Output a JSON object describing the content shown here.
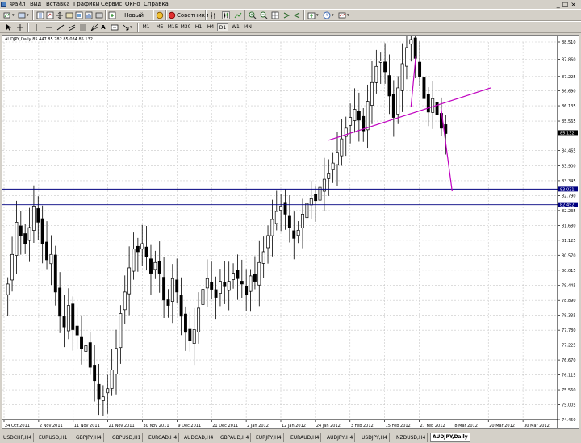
{
  "menubar": {
    "items": [
      "Файл",
      "Вид",
      "Вставка",
      "Графики",
      "Сервис",
      "Окно",
      "Справка"
    ]
  },
  "toolbar": {
    "new_order_label": "Новый Ордер",
    "advisors_label": "Советники",
    "timeframes": [
      "M1",
      "M5",
      "M15",
      "M30",
      "H1",
      "H4",
      "D1",
      "W1",
      "MN"
    ],
    "active_timeframe": "D1"
  },
  "chart": {
    "info": "AUDJPY,Daily  85.447 85.782 85.034 85.132",
    "current_price_tag": "85.132",
    "hline_upper_tag": "83.031",
    "hline_lower_tag": "82.452",
    "price_labels": [
      "88.510",
      "87.860",
      "87.225",
      "86.690",
      "86.135",
      "85.565",
      "84.465",
      "83.900",
      "83.345",
      "82.790",
      "82.235",
      "81.680",
      "81.125",
      "80.570",
      "80.015",
      "79.445",
      "78.890",
      "78.335",
      "77.780",
      "77.225",
      "76.670",
      "76.115",
      "75.560",
      "75.005",
      "74.450"
    ],
    "date_labels": [
      "24 Oct 2011",
      "2 Nov 2011",
      "11 Nov 2011",
      "21 Nov 2011",
      "30 Nov 2011",
      "9 Dec 2011",
      "21 Dec 2011",
      "2 Jan 2012",
      "12 Jan 2012",
      "24 Jan 2012",
      "3 Feb 2012",
      "15 Feb 2012",
      "27 Feb 2012",
      "8 Mar 2012",
      "20 Mar 2012",
      "30 Mar 2012"
    ],
    "colors": {
      "background": "#ffffff",
      "candle": "#000000",
      "grid": "#c8c8c8",
      "hline": "#000080",
      "trendline": "#c000c0"
    }
  },
  "chart_data": {
    "type": "candlestick",
    "symbol": "AUDJPY",
    "timeframe": "Daily",
    "ylim": [
      74.45,
      88.51
    ],
    "candles_close_approx": [
      79.5,
      80.6,
      81.8,
      81.3,
      81.0,
      81.6,
      82.4,
      81.8,
      81.0,
      80.4,
      80.6,
      79.2,
      78.3,
      77.9,
      78.7,
      77.8,
      77.6,
      77.1,
      77.2,
      76.4,
      75.9,
      75.2,
      75.3,
      75.6,
      76.3,
      77.1,
      78.4,
      79.2,
      80.1,
      80.8,
      80.7,
      81.0,
      80.5,
      79.9,
      80.3,
      79.9,
      78.9,
      78.7,
      79.7,
      79.2,
      78.3,
      77.7,
      77.4,
      77.8,
      78.6,
      79.3,
      79.7,
      79.3,
      79.0,
      79.6,
      79.4,
      79.6,
      79.9,
      79.7,
      79.5,
      79.1,
      79.8,
      79.6,
      80.3,
      80.7,
      81.3,
      81.9,
      82.2,
      82.4,
      82.1,
      81.6,
      81.2,
      81.5,
      82.1,
      82.5,
      82.7,
      82.6,
      83.1,
      83.4,
      83.6,
      84.0,
      84.4,
      84.9,
      85.3,
      85.7,
      86.0,
      85.6,
      85.2,
      86.3,
      87.0,
      87.6,
      87.8,
      87.4,
      86.5,
      85.7,
      86.8,
      87.7,
      88.3,
      88.6,
      87.9,
      87.2,
      86.4,
      85.9,
      86.4,
      85.8,
      85.3,
      85.1
    ]
  },
  "tabs": [
    {
      "label": "USDCHF,H4"
    },
    {
      "label": "EURUSD,H1"
    },
    {
      "label": "GBPJPY,H4"
    },
    {
      "label": "GBPUSD,H1"
    },
    {
      "label": "EURCAD,H4"
    },
    {
      "label": "AUDCAD,H4"
    },
    {
      "label": "GBPAUD,H4"
    },
    {
      "label": "EURJPY,H4"
    },
    {
      "label": "EURAUD,H4"
    },
    {
      "label": "AUDJPY,H4"
    },
    {
      "label": "USDJPY,H4"
    },
    {
      "label": "NZDUSD,H4"
    },
    {
      "label": "AUDJPY,Daily",
      "active": true
    }
  ]
}
